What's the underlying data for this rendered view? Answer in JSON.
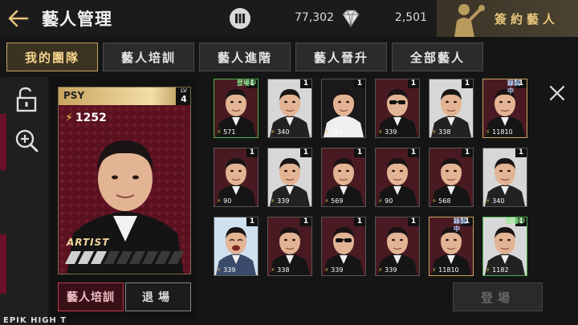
{
  "header": {
    "title": "藝人管理",
    "resources": [
      {
        "icon": "album-icon",
        "value": "77,302"
      },
      {
        "icon": "diamond-icon",
        "value": "2,501"
      }
    ],
    "sign_label": "簽約藝人"
  },
  "tabs": [
    {
      "label": "我的團隊",
      "active": true
    },
    {
      "label": "藝人培訓",
      "active": false
    },
    {
      "label": "藝人進階",
      "active": false
    },
    {
      "label": "藝人晉升",
      "active": false
    },
    {
      "label": "全部藝人",
      "active": false
    }
  ],
  "tools": [
    "unlock-icon",
    "zoom-in-icon"
  ],
  "detail": {
    "name": "PSY",
    "lv_label": "LV",
    "lv_value": "4",
    "power": "1252",
    "logo_text": "ARTIST",
    "train_label": "藝人培訓",
    "exit_label": "退場"
  },
  "grid": {
    "columns": 6,
    "cards": [
      {
        "power": "571",
        "level": "1",
        "badge": "登場中",
        "badge_type": "onstage",
        "frame": "green",
        "look": "grin"
      },
      {
        "power": "340",
        "level": "1",
        "badge": "",
        "badge_type": "",
        "frame": "plain",
        "look": "suit"
      },
      {
        "power": "341",
        "level": "1",
        "badge": "",
        "badge_type": "",
        "frame": "plain",
        "look": "white"
      },
      {
        "power": "339",
        "level": "1",
        "badge": "",
        "badge_type": "",
        "frame": "plain",
        "look": "shades"
      },
      {
        "power": "338",
        "level": "1",
        "badge": "",
        "badge_type": "",
        "frame": "plain",
        "look": "suit"
      },
      {
        "power": "11810",
        "level": "1",
        "badge": "錄製中",
        "badge_type": "recording",
        "frame": "gold",
        "look": "grin"
      },
      {
        "power": "90",
        "level": "1",
        "badge": "",
        "badge_type": "",
        "frame": "plain",
        "look": "grin"
      },
      {
        "power": "339",
        "level": "1",
        "badge": "",
        "badge_type": "",
        "frame": "plain",
        "look": "suit"
      },
      {
        "power": "569",
        "level": "1",
        "badge": "",
        "badge_type": "",
        "frame": "plain",
        "look": "grin"
      },
      {
        "power": "90",
        "level": "1",
        "badge": "",
        "badge_type": "",
        "frame": "plain",
        "look": "grin"
      },
      {
        "power": "568",
        "level": "1",
        "badge": "",
        "badge_type": "",
        "frame": "plain",
        "look": "grin"
      },
      {
        "power": "340",
        "level": "1",
        "badge": "",
        "badge_type": "",
        "frame": "plain",
        "look": "suit"
      },
      {
        "power": "339",
        "level": "1",
        "badge": "",
        "badge_type": "",
        "frame": "plain",
        "look": "laugh"
      },
      {
        "power": "338",
        "level": "1",
        "badge": "",
        "badge_type": "",
        "frame": "plain",
        "look": "grin"
      },
      {
        "power": "339",
        "level": "1",
        "badge": "",
        "badge_type": "",
        "frame": "plain",
        "look": "shades"
      },
      {
        "power": "339",
        "level": "1",
        "badge": "",
        "badge_type": "",
        "frame": "plain",
        "look": "grin"
      },
      {
        "power": "11810",
        "level": "1",
        "badge": "錄製中",
        "badge_type": "recording",
        "frame": "gold",
        "look": "grin"
      },
      {
        "power": "1182",
        "level": "1",
        "badge": "登場中",
        "badge_type": "onstage",
        "frame": "green",
        "look": "suit"
      }
    ]
  },
  "stage_label": "登場",
  "bottom_caption": "EPIK HIGH T",
  "colors": {
    "accent_gold": "#c9a460",
    "accent_red": "#c0394b",
    "onstage_green": "#4caf50"
  }
}
